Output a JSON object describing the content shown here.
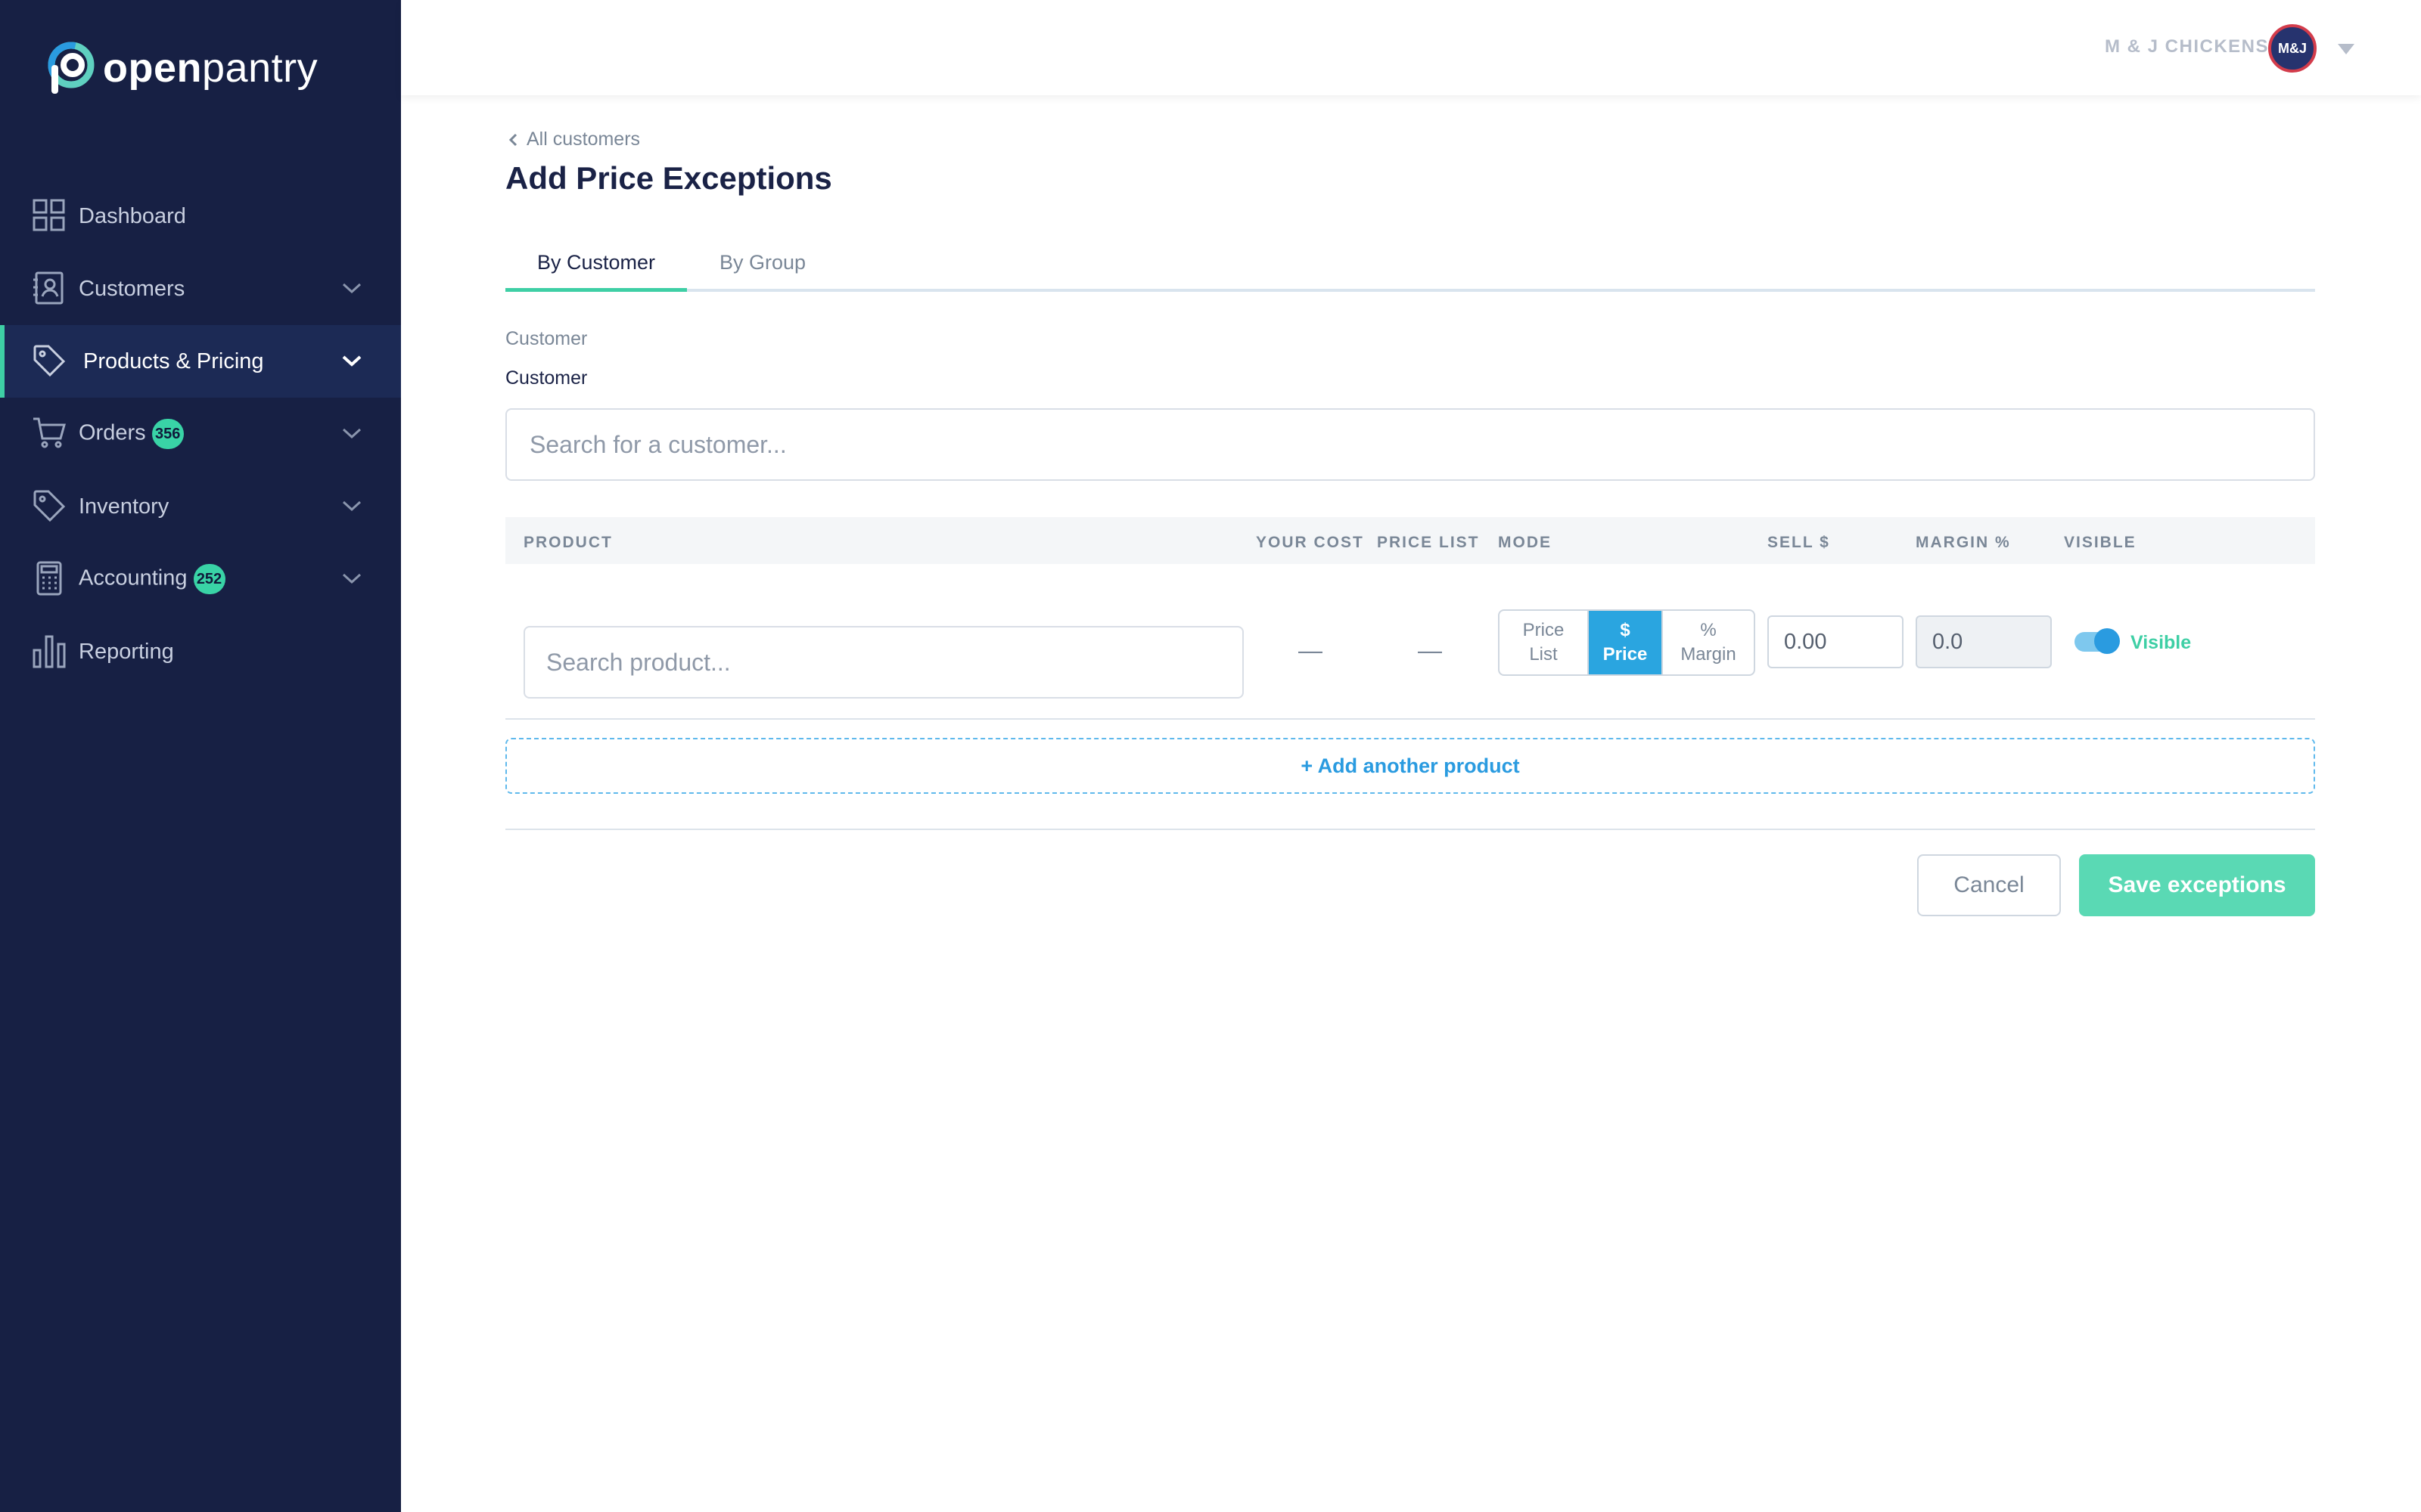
{
  "brand": {
    "name_bold": "open",
    "name_regular": "pantry",
    "accent": "#3ecfa5",
    "sidebar_bg": "#172044"
  },
  "sidebar": {
    "items": [
      {
        "label": "Dashboard",
        "icon": "dashboard-icon",
        "has_chevron": false
      },
      {
        "label": "Customers",
        "icon": "customers-icon",
        "has_chevron": true
      },
      {
        "label": "Products & Pricing",
        "icon": "tag-icon",
        "has_chevron": true,
        "active": true
      },
      {
        "label": "Orders",
        "icon": "cart-icon",
        "has_chevron": true,
        "badge": "356"
      },
      {
        "label": "Inventory",
        "icon": "tag-icon",
        "has_chevron": true
      },
      {
        "label": "Accounting",
        "icon": "calculator-icon",
        "has_chevron": true,
        "badge": "252"
      },
      {
        "label": "Reporting",
        "icon": "bar-chart-icon",
        "has_chevron": false
      }
    ]
  },
  "header": {
    "company": "M & J CHICKENS",
    "avatar_text": "M&J"
  },
  "page": {
    "back_link": "All customers",
    "title": "Add Price Exceptions",
    "tabs": [
      {
        "label": "By Customer",
        "active": true
      },
      {
        "label": "By Group",
        "active": false
      }
    ],
    "section_label": "Customer",
    "customer_field_label": "Customer",
    "customer_search_placeholder": "Search for a customer..."
  },
  "table": {
    "headers": {
      "product": "PRODUCT",
      "your_cost": "YOUR COST",
      "price_list": "PRICE LIST",
      "mode": "MODE",
      "sell": "SELL $",
      "margin": "MARGIN %",
      "visible": "VISIBLE"
    },
    "row": {
      "product_placeholder": "Search product...",
      "your_cost": "—",
      "price_list": "—",
      "mode_options": [
        {
          "line1": "Price",
          "line2": "List"
        },
        {
          "line1": "$",
          "line2": "Price",
          "selected": true
        },
        {
          "line1": "%",
          "line2": "Margin"
        }
      ],
      "sell_value": "0.00",
      "margin_value": "0.0",
      "visible_on": true,
      "visible_label": "Visible"
    },
    "add_row_label": "+ Add another product"
  },
  "actions": {
    "cancel": "Cancel",
    "save": "Save exceptions"
  }
}
